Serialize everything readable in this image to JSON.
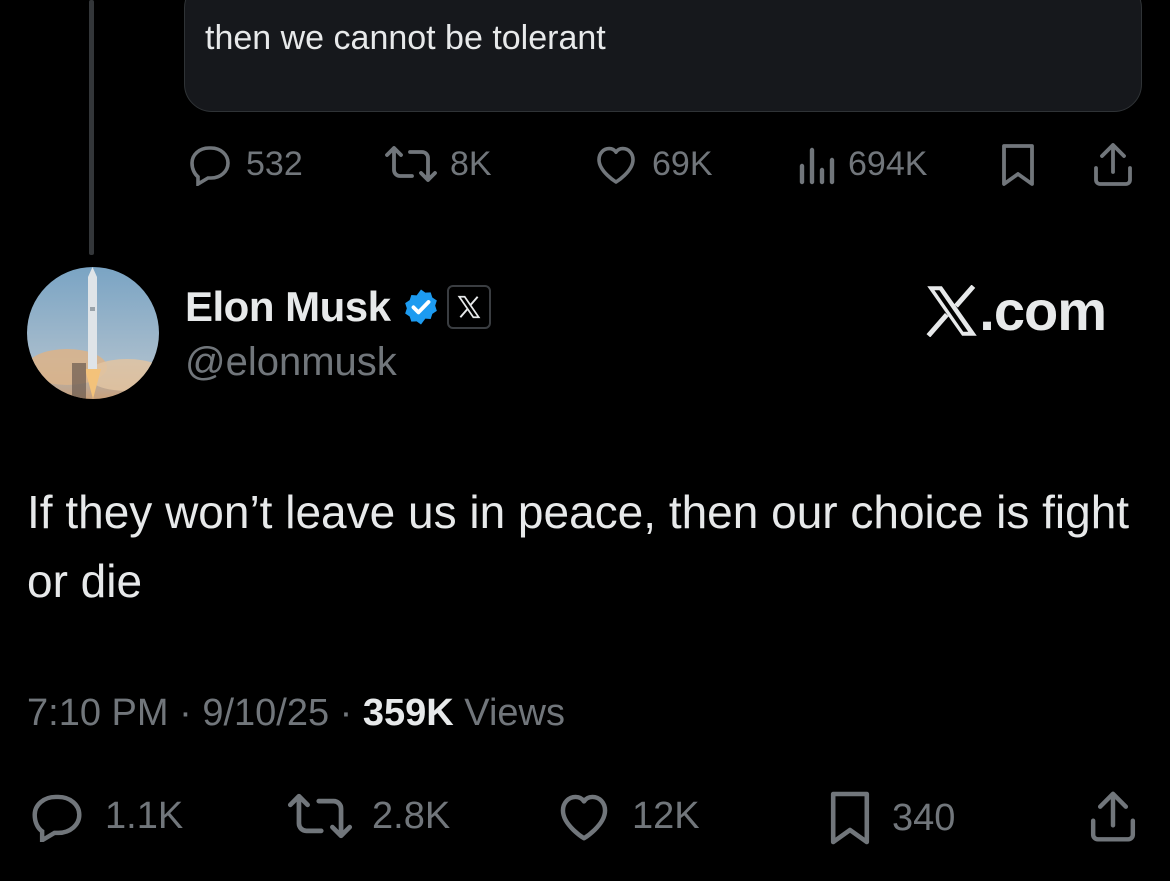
{
  "quoted_post": {
    "text": "then we cannot be tolerant"
  },
  "quoted_actions": {
    "replies": "532",
    "reposts": "8K",
    "likes": "69K",
    "views": "694K"
  },
  "author": {
    "name": "Elon Musk",
    "handle": "@elonmusk",
    "verified_color": "#1d9bf0"
  },
  "brand": {
    "label": ".com"
  },
  "post": {
    "text": "If they won’t leave us in peace, then our choice is fight or die"
  },
  "meta": {
    "time": "7:10 PM",
    "sep1": " · ",
    "date": "9/10/25",
    "sep2": " · ",
    "views_count": "359K",
    "views_label": " Views"
  },
  "actions": {
    "replies": "1.1K",
    "reposts": "2.8K",
    "likes": "12K",
    "bookmarks": "340"
  },
  "icons": [
    "reply-icon",
    "repost-icon",
    "like-icon",
    "views-icon",
    "bookmark-icon",
    "share-icon",
    "verified-badge-icon",
    "x-logo-icon"
  ]
}
